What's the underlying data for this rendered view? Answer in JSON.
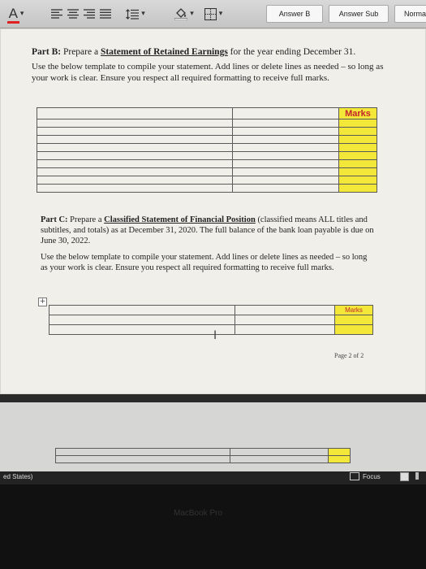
{
  "toolbar": {
    "answer_b_label": "Answer B",
    "answer_sub_label": "Answer Sub",
    "normal_label": "Norma"
  },
  "part_b": {
    "lead": "Part B:",
    "text_before": "Prepare a",
    "link": "Statement of Retained Earnings",
    "text_after": "for the year ending December 31.",
    "instructions": "Use the below template to compile your statement. Add lines or delete lines as needed – so long as your work is clear. Ensure you respect all required formatting to receive full marks.",
    "marks_header": "Marks"
  },
  "part_c": {
    "lead": "Part C:",
    "text_before": "Prepare a",
    "link": "Classified Statement of Financial Position",
    "text_after": "(classified means ALL titles and subtitles, and totals) as at December 31, 2020. The full balance of the bank loan payable is due on June 30, 2022.",
    "instructions": "Use the below template to compile your statement. Add lines or delete lines as needed – so long as your work is clear. Ensure you respect all required formatting to receive full marks.",
    "marks_header": "Marks"
  },
  "page_number": "Page 2 of 2",
  "statusbar": {
    "language": "ed States)",
    "focus_label": "Focus"
  },
  "laptop_label": "MacBook Pro"
}
